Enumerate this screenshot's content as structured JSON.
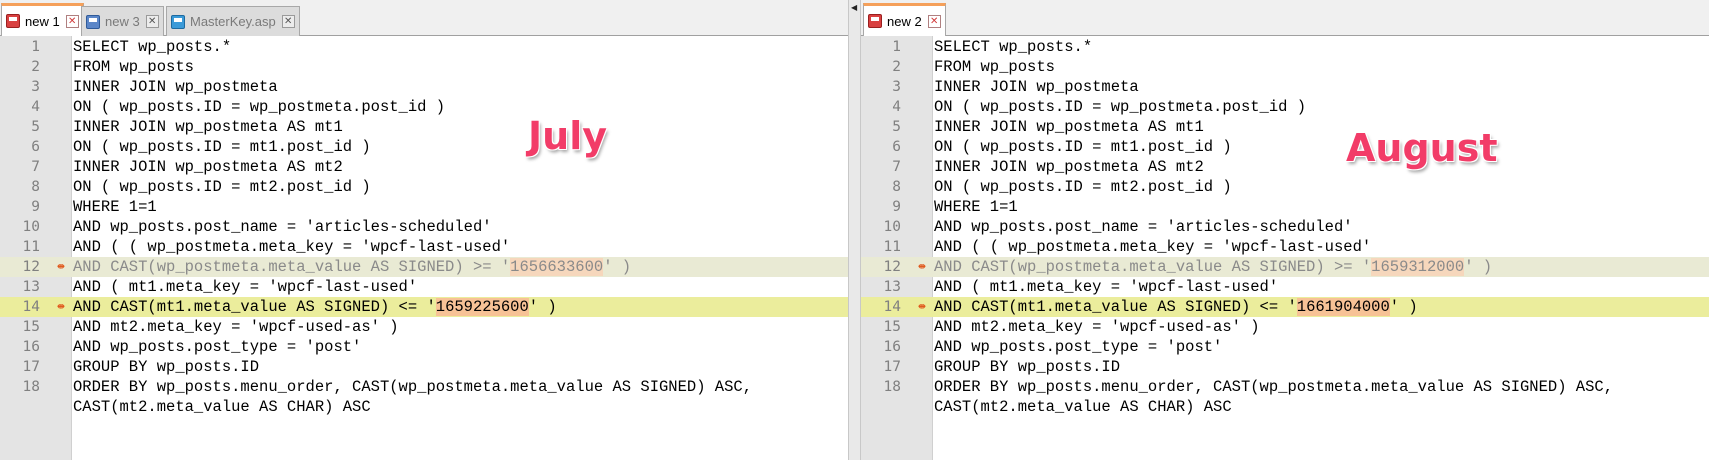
{
  "left_pane": {
    "tabs": [
      {
        "label": "new 1",
        "active": true,
        "icon": "red-file-icon"
      },
      {
        "label": "new 3",
        "active": false,
        "icon": "blue-file-icon"
      },
      {
        "label": "MasterKey.asp",
        "active": false,
        "icon": "asp-file-icon"
      }
    ],
    "annotation": "July",
    "lines": [
      {
        "num": "1",
        "pre": "SELECT wp_posts.*",
        "val": "",
        "post": ""
      },
      {
        "num": "2",
        "pre": "FROM wp_posts",
        "val": "",
        "post": ""
      },
      {
        "num": "3",
        "pre": "INNER JOIN wp_postmeta",
        "val": "",
        "post": ""
      },
      {
        "num": "4",
        "pre": "ON ( wp_posts.ID = wp_postmeta.post_id )",
        "val": "",
        "post": ""
      },
      {
        "num": "5",
        "pre": "INNER JOIN wp_postmeta AS mt1",
        "val": "",
        "post": ""
      },
      {
        "num": "6",
        "pre": "ON ( wp_posts.ID = mt1.post_id )",
        "val": "",
        "post": ""
      },
      {
        "num": "7",
        "pre": "INNER JOIN wp_postmeta AS mt2",
        "val": "",
        "post": ""
      },
      {
        "num": "8",
        "pre": "ON ( wp_posts.ID = mt2.post_id )",
        "val": "",
        "post": ""
      },
      {
        "num": "9",
        "pre": "WHERE 1=1",
        "val": "",
        "post": ""
      },
      {
        "num": "10",
        "pre": "AND wp_posts.post_name = 'articles-scheduled'",
        "val": "",
        "post": ""
      },
      {
        "num": "11",
        "pre": "AND ( ( wp_postmeta.meta_key = 'wpcf-last-used'",
        "val": "",
        "post": ""
      },
      {
        "num": "12",
        "pre": "AND CAST(wp_postmeta.meta_value AS SIGNED) >= '",
        "val": "1656633600",
        "post": "' )"
      },
      {
        "num": "13",
        "pre": "AND ( mt1.meta_key = 'wpcf-last-used'",
        "val": "",
        "post": ""
      },
      {
        "num": "14",
        "pre": "AND CAST(mt1.meta_value AS SIGNED) <= '",
        "val": "1659225600",
        "post": "' )"
      },
      {
        "num": "15",
        "pre": "AND mt2.meta_key = 'wpcf-used-as' )",
        "val": "",
        "post": ""
      },
      {
        "num": "16",
        "pre": "AND wp_posts.post_type = 'post'",
        "val": "",
        "post": ""
      },
      {
        "num": "17",
        "pre": "GROUP BY wp_posts.ID",
        "val": "",
        "post": ""
      },
      {
        "num": "18",
        "pre": "ORDER BY wp_posts.menu_order, CAST(wp_postmeta.meta_value AS SIGNED) ASC,",
        "val": "",
        "post": ""
      },
      {
        "num": "",
        "pre": "CAST(mt2.meta_value AS CHAR) ASC",
        "val": "",
        "post": ""
      }
    ]
  },
  "right_pane": {
    "tabs": [
      {
        "label": "new 2",
        "active": true,
        "icon": "red-file-icon"
      }
    ],
    "annotation": "August",
    "lines": [
      {
        "num": "1",
        "pre": "SELECT wp_posts.*",
        "val": "",
        "post": ""
      },
      {
        "num": "2",
        "pre": "FROM wp_posts",
        "val": "",
        "post": ""
      },
      {
        "num": "3",
        "pre": "INNER JOIN wp_postmeta",
        "val": "",
        "post": ""
      },
      {
        "num": "4",
        "pre": "ON ( wp_posts.ID = wp_postmeta.post_id )",
        "val": "",
        "post": ""
      },
      {
        "num": "5",
        "pre": "INNER JOIN wp_postmeta AS mt1",
        "val": "",
        "post": ""
      },
      {
        "num": "6",
        "pre": "ON ( wp_posts.ID = mt1.post_id )",
        "val": "",
        "post": ""
      },
      {
        "num": "7",
        "pre": "INNER JOIN wp_postmeta AS mt2",
        "val": "",
        "post": ""
      },
      {
        "num": "8",
        "pre": "ON ( wp_posts.ID = mt2.post_id )",
        "val": "",
        "post": ""
      },
      {
        "num": "9",
        "pre": "WHERE 1=1",
        "val": "",
        "post": ""
      },
      {
        "num": "10",
        "pre": "AND wp_posts.post_name = 'articles-scheduled'",
        "val": "",
        "post": ""
      },
      {
        "num": "11",
        "pre": "AND ( ( wp_postmeta.meta_key = 'wpcf-last-used'",
        "val": "",
        "post": ""
      },
      {
        "num": "12",
        "pre": "AND CAST(wp_postmeta.meta_value AS SIGNED) >= '",
        "val": "1659312000",
        "post": "' )"
      },
      {
        "num": "13",
        "pre": "AND ( mt1.meta_key = 'wpcf-last-used'",
        "val": "",
        "post": ""
      },
      {
        "num": "14",
        "pre": "AND CAST(mt1.meta_value AS SIGNED) <= '",
        "val": "1661904000",
        "post": "' )"
      },
      {
        "num": "15",
        "pre": "AND mt2.meta_key = 'wpcf-used-as' )",
        "val": "",
        "post": ""
      },
      {
        "num": "16",
        "pre": "AND wp_posts.post_type = 'post'",
        "val": "",
        "post": ""
      },
      {
        "num": "17",
        "pre": "GROUP BY wp_posts.ID",
        "val": "",
        "post": ""
      },
      {
        "num": "18",
        "pre": "ORDER BY wp_posts.menu_order, CAST(wp_postmeta.meta_value AS SIGNED) ASC,",
        "val": "",
        "post": ""
      },
      {
        "num": "",
        "pre": "CAST(mt2.meta_value AS CHAR) ASC",
        "val": "",
        "post": ""
      }
    ]
  },
  "colors": {
    "annotation": "#f23c68",
    "value_highlight": "#f7c296",
    "current_line": "#ebed9c",
    "active_tab_accent": "#f5a05a"
  }
}
